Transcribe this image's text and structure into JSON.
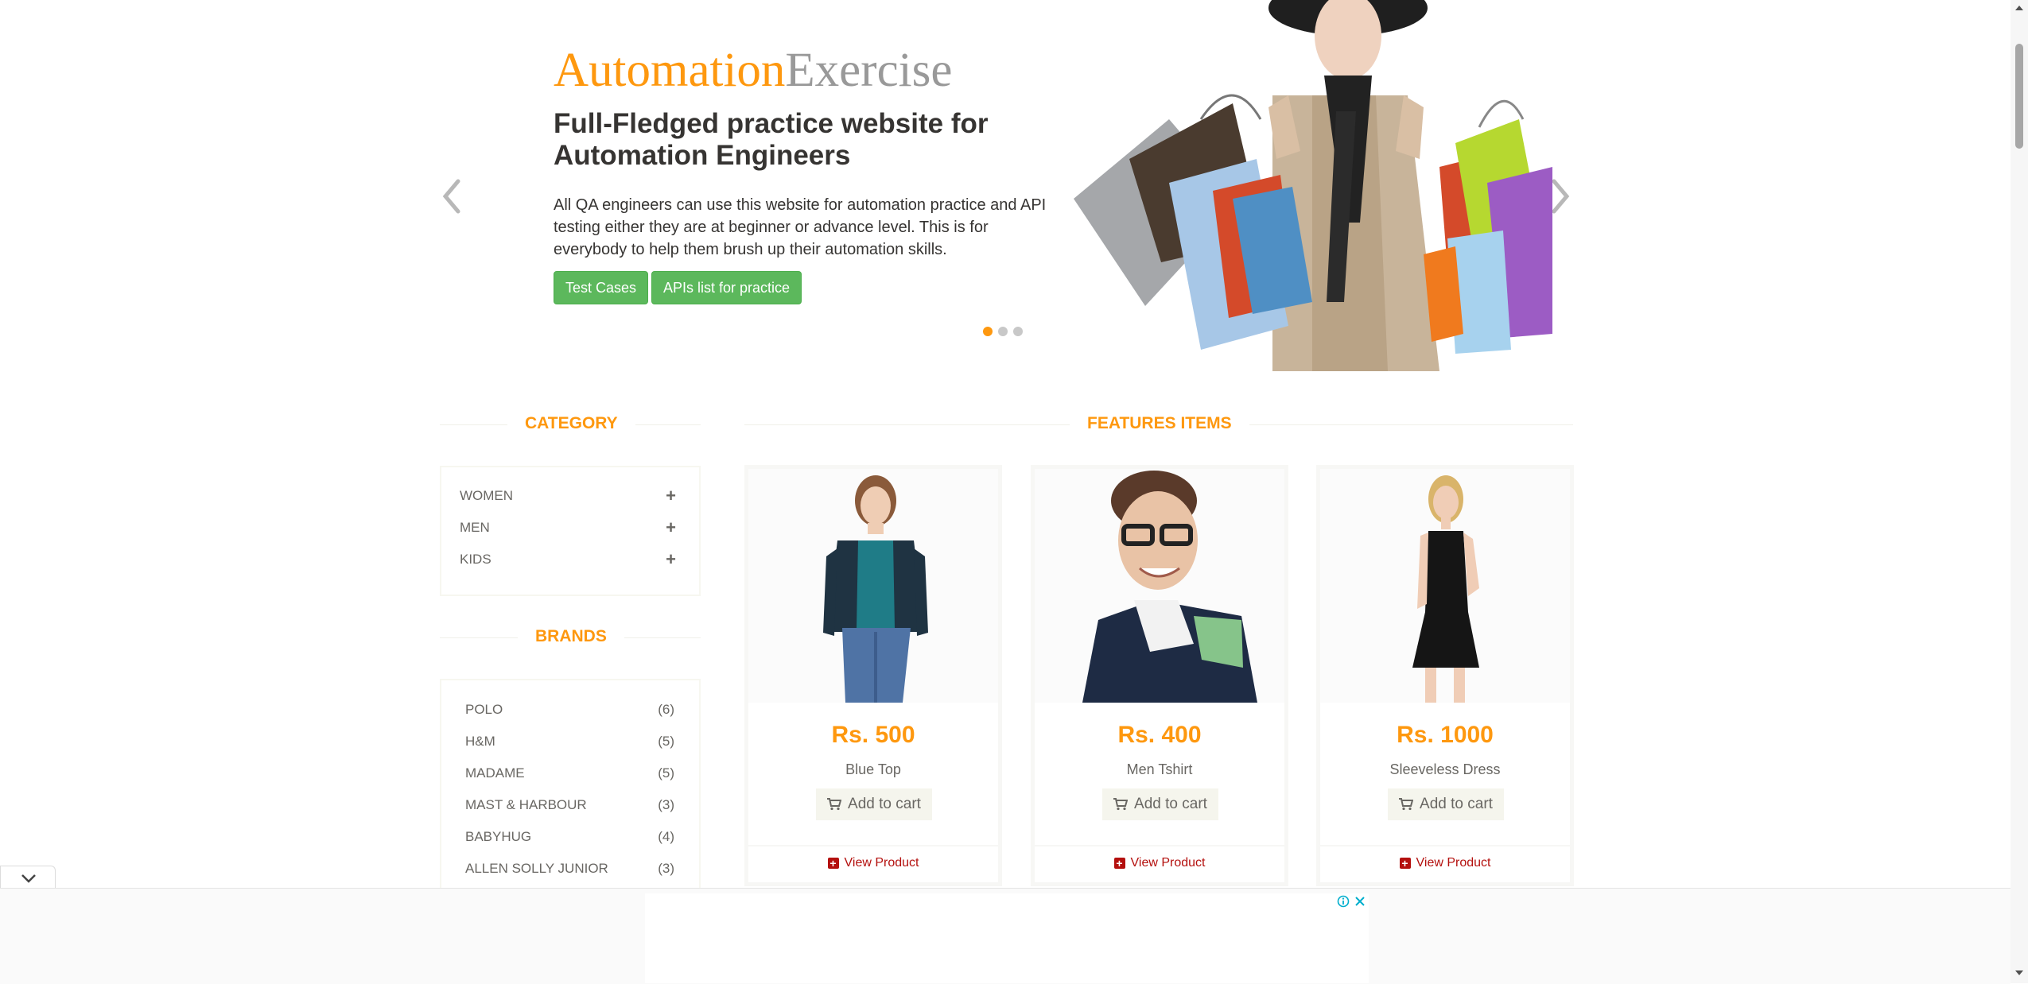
{
  "hero": {
    "brand_part1": "Automation",
    "brand_part2": "Exercise",
    "title": "Full-Fledged practice website for Automation Engineers",
    "description": "All QA engineers can use this website for automation practice and API testing either they are at beginner or advance level. This is for everybody to help them brush up their automation skills.",
    "btn_test_cases": "Test Cases",
    "btn_apis": "APIs list for practice",
    "slide_count": 3,
    "active_slide": 1
  },
  "sidebar": {
    "category_title": "Category",
    "categories": [
      {
        "label": "Women"
      },
      {
        "label": "Men"
      },
      {
        "label": "Kids"
      }
    ],
    "brands_title": "Brands",
    "brands": [
      {
        "label": "POLO",
        "count": "(6)"
      },
      {
        "label": "H&M",
        "count": "(5)"
      },
      {
        "label": "MADAME",
        "count": "(5)"
      },
      {
        "label": "MAST & HARBOUR",
        "count": "(3)"
      },
      {
        "label": "BABYHUG",
        "count": "(4)"
      },
      {
        "label": "ALLEN SOLLY JUNIOR",
        "count": "(3)"
      }
    ]
  },
  "features": {
    "title": "Features Items",
    "add_to_cart_label": "Add to cart",
    "view_product_label": "View Product",
    "products": [
      {
        "price": "Rs. 500",
        "name": "Blue Top"
      },
      {
        "price": "Rs. 400",
        "name": "Men Tshirt"
      },
      {
        "price": "Rs. 1000",
        "name": "Sleeveless Dress"
      }
    ]
  },
  "colors": {
    "accent": "#FE980F",
    "button_green": "#5cb85c",
    "view_product": "#B4100E",
    "muted_text": "#696763"
  },
  "icons": [
    "chevron-left-icon",
    "chevron-right-icon",
    "plus-icon",
    "cart-icon",
    "plus-square-icon",
    "chevron-down-icon",
    "ad-info-icon",
    "ad-close-icon"
  ]
}
